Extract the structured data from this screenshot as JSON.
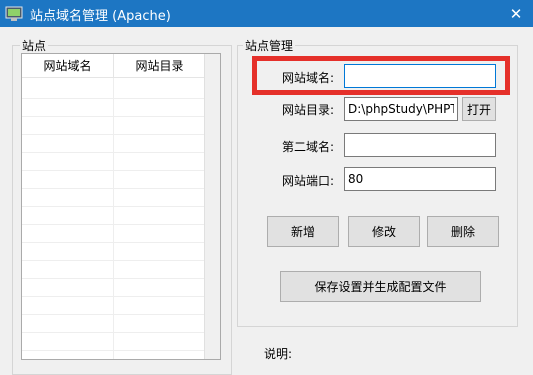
{
  "window": {
    "title": "站点域名管理 (Apache)",
    "close_glyph": "✕"
  },
  "sites_group": {
    "label": "站点",
    "columns": [
      "网站域名",
      "网站目录"
    ],
    "rows": []
  },
  "manage_group": {
    "label": "站点管理",
    "domain_label": "网站域名:",
    "domain_value": "",
    "dir_label": "网站目录:",
    "dir_value": "D:\\phpStudy\\PHPTutorial\\WWW",
    "open_button": "打开",
    "second_domain_label": "第二域名:",
    "second_domain_value": "",
    "port_label": "网站端口:",
    "port_value": "80",
    "add_button": "新增",
    "edit_button": "修改",
    "delete_button": "删除",
    "save_button": "保存设置并生成配置文件"
  },
  "notes": {
    "label": "说明:"
  },
  "colors": {
    "titlebar": "#1d76c3",
    "highlight": "#e5302a",
    "window_bg": "#f0f0f0"
  }
}
